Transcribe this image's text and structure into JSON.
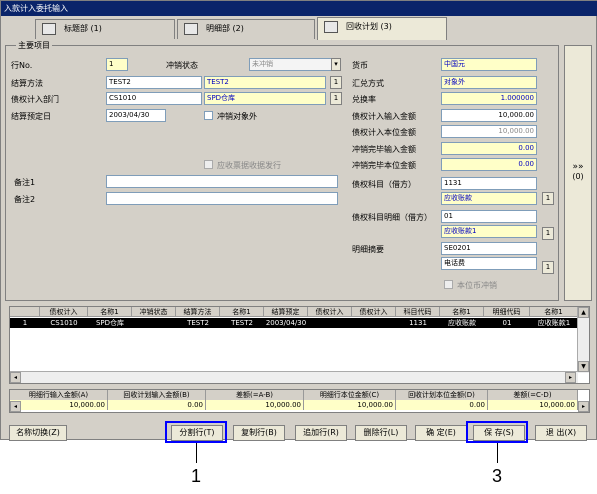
{
  "window": {
    "title": "入款计入委托输入"
  },
  "tabs": [
    {
      "label": "标题部 (1)"
    },
    {
      "label": "明细部 (2)"
    },
    {
      "label": "回收计划 (3)"
    }
  ],
  "main": {
    "group_label": "主要项目",
    "line_no_label": "行No.",
    "line_no_value": "1",
    "offset_status_label": "冲销状态",
    "offset_status_value": "未冲销",
    "settle_method_label": "结算方法",
    "settle_method_code": "TEST2",
    "settle_method_name": "TEST2",
    "dept_label": "债权计入部门",
    "dept_code": "CS1010",
    "dept_name": "SPD仓库",
    "settle_date_label": "结算预定日",
    "settle_date_value": "2003/04/30",
    "offset_target_label": "冲销对象外",
    "receivable_issue_label": "应收票据收据发行",
    "note1_label": "备注1",
    "note2_label": "备注2",
    "currency_label": "货币",
    "currency_value": "中国元",
    "exchange_method_label": "汇兑方式",
    "exchange_method_value": "对象外",
    "exchange_rate_label": "兑换率",
    "exchange_rate_value": "1.000000",
    "input_amount_label": "债权计入输入金额",
    "input_amount_value": "10,000.00",
    "local_amount_label": "债权计入本位金额",
    "local_amount_value": "10,000.00",
    "offset_input_label": "冲销完毕输入金额",
    "offset_input_value": "0.00",
    "offset_local_label": "冲销完毕本位金额",
    "offset_local_value": "0.00",
    "debit_subject_label": "债权科目（借方）",
    "debit_subject_code": "1131",
    "debit_subject_name": "应收账款",
    "debit_detail_label": "债权科目明细（借方）",
    "debit_detail_code": "01",
    "debit_detail_name": "应收账款1",
    "summary_label": "明细摘要",
    "summary_code": "SE0201",
    "summary_name": "电话费",
    "local_offset_label": "本位币冲销",
    "btn_one": "1",
    "expand_label": "»»",
    "expand_key": "(0)"
  },
  "grid": {
    "columns": [
      "债权计入",
      "名称1",
      "冲销状态",
      "结算方法",
      "名称1",
      "结算预定",
      "债权计入",
      "债权计入",
      "科目代码",
      "名称1",
      "明细代码",
      "名称1"
    ],
    "rows": [
      [
        "1",
        "CS1010",
        "SPD仓库",
        "",
        "TEST2",
        "TEST2",
        "2003/04/30",
        "",
        "",
        "1131",
        "应收账款",
        "01",
        "应收账款1"
      ]
    ]
  },
  "sums": {
    "headers": [
      "明细行输入金额(A)",
      "回收计划输入金额(B)",
      "差额(=A-B)",
      "明细行本位金额(C)",
      "回收计划本位金额(D)",
      "差额(=C-D)"
    ],
    "values": [
      "10,000.00",
      "0.00",
      "10,000.00",
      "10,000.00",
      "0.00",
      "10,000.00"
    ]
  },
  "buttons": {
    "name_switch": "名称切换(Z)",
    "split": "分割行(T)",
    "copy": "复制行(B)",
    "add": "追加行(R)",
    "delete": "删除行(L)",
    "confirm": "确 定(E)",
    "save": "保 存(S)",
    "exit": "退 出(X)"
  },
  "callouts": [
    "1",
    "3"
  ],
  "colors": {
    "title_bar": "#0a246a",
    "highlight": "#0000ff",
    "required_field": "#ffffc8"
  }
}
